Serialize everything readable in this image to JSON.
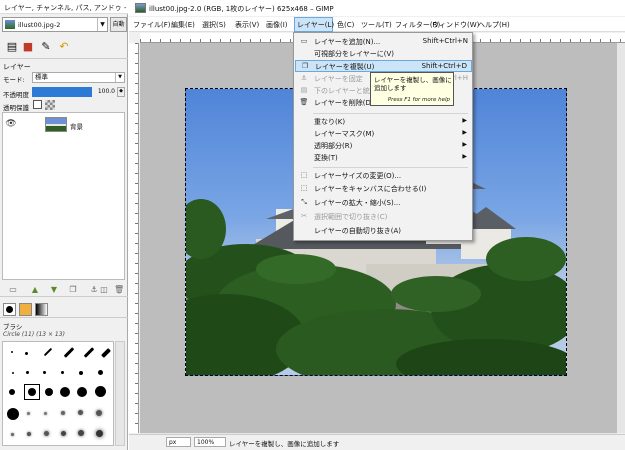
{
  "dock": {
    "title": "レイヤー, チャンネル, パス, アンドゥ - ブ...",
    "image_selector": "illust00.jpg-2",
    "auto_button": "自動",
    "layers_heading": "レイヤー",
    "mode_label": "モード:",
    "mode_value": "標準",
    "opacity_label": "不透明度",
    "opacity_value": "100.0",
    "opacity_fraction": 1.0,
    "lock_label": "透明保護",
    "layer": {
      "name": "背景"
    },
    "brushes_heading": "ブラシ",
    "brush_info": "Circle (11) (13 × 13)"
  },
  "window": {
    "title": "illust00.jpg-2.0 (RGB, 1枚のレイヤー) 625x468 – GIMP"
  },
  "menubar": {
    "items": [
      "ファイル(F)",
      "編集(E)",
      "選択(S)",
      "表示(V)",
      "画像(I)",
      "レイヤー(L)",
      "色(C)",
      "ツール(T)",
      "フィルター(R)",
      "ウィンドウ(W)",
      "ヘルプ(H)"
    ]
  },
  "menu": {
    "items": [
      {
        "label": "レイヤーを追加(N)...",
        "shortcut": "Shift+Ctrl+N"
      },
      {
        "label": "可視部分をレイヤーに(V)",
        "shortcut": ""
      },
      {
        "label": "レイヤーを複製(U)",
        "shortcut": "Shift+Ctrl+D"
      },
      {
        "label": "レイヤーを固定",
        "shortcut": "Ctrl+H"
      },
      {
        "label": "下のレイヤーと統合(W)",
        "shortcut": ""
      },
      {
        "label": "レイヤーを削除(D)",
        "shortcut": ""
      },
      {
        "label": "重なり(K)",
        "shortcut": ""
      },
      {
        "label": "レイヤーマスク(M)",
        "shortcut": ""
      },
      {
        "label": "透明部分(R)",
        "shortcut": ""
      },
      {
        "label": "変換(T)",
        "shortcut": ""
      },
      {
        "label": "レイヤーサイズの変更(O)...",
        "shortcut": ""
      },
      {
        "label": "レイヤーをキャンバスに合わせる(I)",
        "shortcut": ""
      },
      {
        "label": "レイヤーの拡大・縮小(S)...",
        "shortcut": ""
      },
      {
        "label": "選択範囲で切り抜き(C)",
        "shortcut": ""
      },
      {
        "label": "レイヤーの自動切り抜き(A)",
        "shortcut": ""
      }
    ]
  },
  "tooltip": {
    "text": "レイヤーを複製し、画像に追加します",
    "help": "Press F1 for more help"
  },
  "status": {
    "unit": "px",
    "zoom": "100%",
    "message": "レイヤーを複製し、画像に追加します"
  },
  "colors": {
    "highlight": "#cce4f7",
    "highlight_border": "#6aa8de",
    "tooltip_bg": "#ffffe1"
  }
}
